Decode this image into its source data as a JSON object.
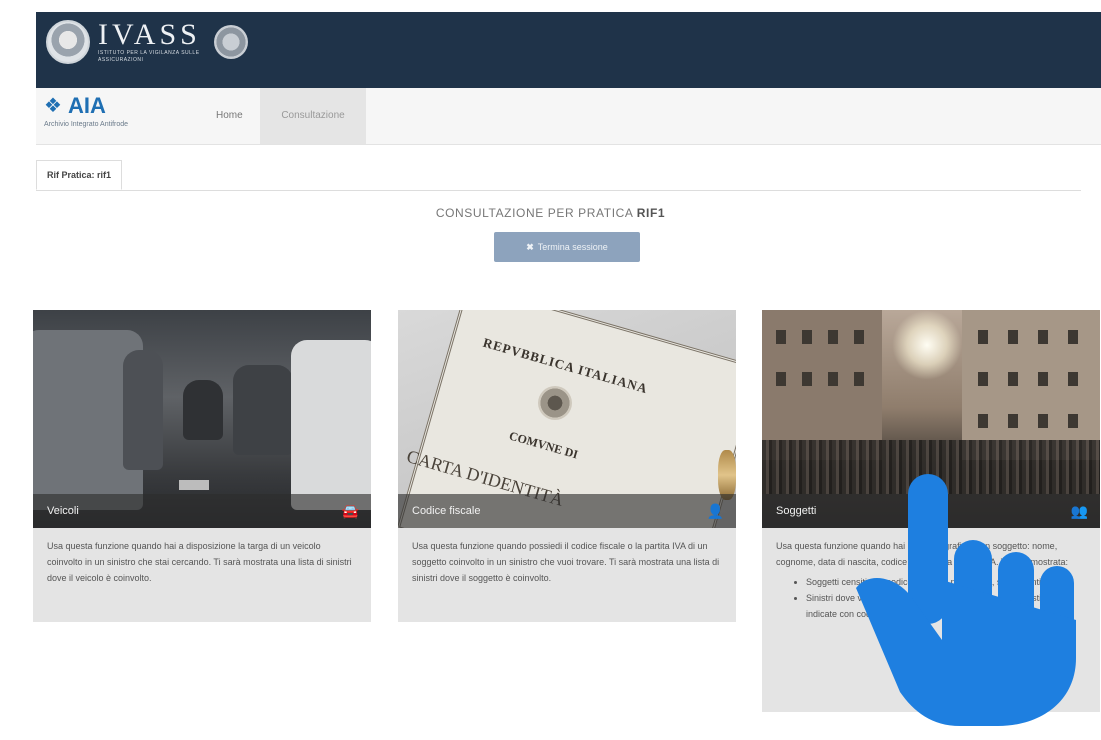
{
  "header": {
    "brand": "IVASS",
    "brand_sub": "ISTITUTO PER LA VIGILANZA SULLE ASSICURAZIONI"
  },
  "navbar": {
    "app_name": "AIA",
    "app_sub": "Archivio Integrato Antifrode",
    "home": "Home",
    "consultazione": "Consultazione"
  },
  "tabs": {
    "active": "Rif Pratica: rif1"
  },
  "main": {
    "title_prefix": "CONSULTAZIONE PER PRATICA",
    "title_code": "RIF1",
    "end_button": "Termina sessione"
  },
  "cards": [
    {
      "caption": "Veicoli",
      "icon": "car-icon",
      "description": "Usa questa funzione quando hai a disposizione la targa di un veicolo coinvolto in un sinistro che stai cercando. Ti sarà mostrata una lista di sinistri dove il veicolo è coinvolto."
    },
    {
      "caption": "Codice fiscale",
      "icon": "user-icon",
      "description": "Usa questa funzione quando possiedi il codice fiscale o la partita IVA di un soggetto coinvolto in un sinistro che vuoi trovare. Ti sarà mostrata una lista di sinistri dove il soggetto è coinvolto."
    },
    {
      "caption": "Soggetti",
      "icon": "users-icon",
      "description": "Usa questa funzione quando hai i dati anagrafici di un soggetto: nome, cognome, data di nascita, codice fiscale o la partita IVA. Ti sarà mostrata:",
      "bullets": [
        "Soggetti censiti con codice fiscale o partita IVA, se presenti",
        "Sinistri dove vengono coinvolti soggetti aventi le caratteristiche indicate con codice fiscale o partita IVA"
      ]
    }
  ],
  "colors": {
    "header_bg": "#1f3349",
    "accent": "#1f6fb3",
    "button_bg": "#8da3bd",
    "card_body_bg": "#e4e4e4",
    "hand": "#1e7fe0"
  }
}
